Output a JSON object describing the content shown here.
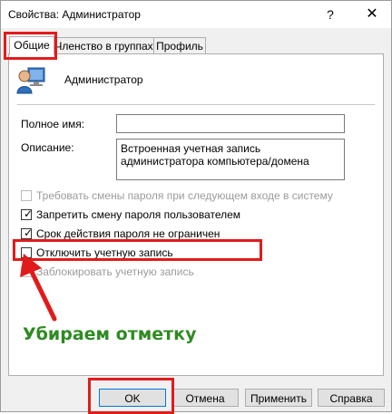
{
  "window": {
    "title": "Свойства: Администратор",
    "help_glyph": "?",
    "close_glyph": "✕"
  },
  "tabs": [
    {
      "label": "Общие",
      "active": true
    },
    {
      "label": "Членство в группах",
      "active": false
    },
    {
      "label": "Профиль",
      "active": false
    }
  ],
  "user": {
    "icon": "user-icon",
    "name": "Администратор"
  },
  "fields": {
    "full_name_label": "Полное имя:",
    "full_name_value": "",
    "description_label": "Описание:",
    "description_value": "Встроенная учетная запись администратора компьютера/домена"
  },
  "checkboxes": [
    {
      "label": "Требовать смены пароля при следующем входе в систему",
      "checked": false,
      "enabled": false
    },
    {
      "label": "Запретить смену пароля пользователем",
      "checked": true,
      "enabled": true
    },
    {
      "label": "Срок действия пароля не ограничен",
      "checked": true,
      "enabled": true
    },
    {
      "label": "Отключить учетную запись",
      "checked": false,
      "enabled": true
    },
    {
      "label": "Заблокировать учетную запись",
      "checked": false,
      "enabled": false
    }
  ],
  "annotation": {
    "text": "Убираем отметку",
    "color": "#2e8b22",
    "highlight_color": "#e11b1b"
  },
  "buttons": {
    "ok": "OK",
    "cancel": "Отмена",
    "apply": "Применить",
    "help": "Справка"
  }
}
